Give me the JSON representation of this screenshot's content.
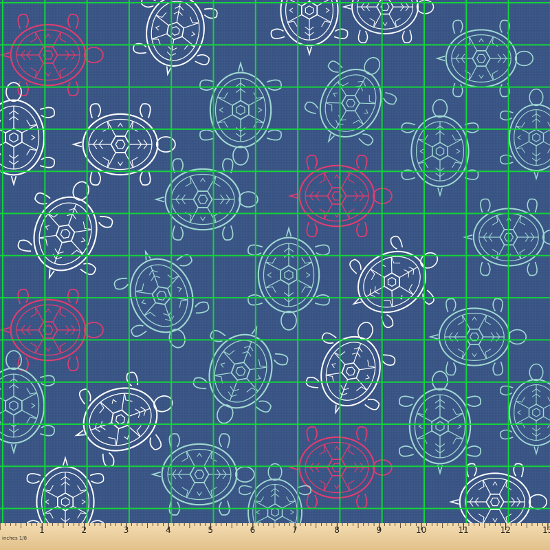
{
  "fabric": {
    "background_color": "#3a5585",
    "grid_color": "#12d33a",
    "motif": "turtle",
    "outline_colors": [
      "#ffffff",
      "#9fd8d2",
      "#e23c6e"
    ]
  },
  "ruler": {
    "unit_label": "inches 1/8",
    "numbers": [
      "1",
      "2",
      "3",
      "4",
      "5",
      "6",
      "7",
      "8",
      "9",
      "10",
      "11",
      "12",
      "13"
    ]
  }
}
